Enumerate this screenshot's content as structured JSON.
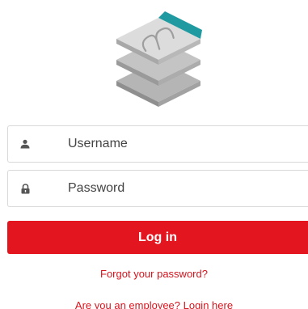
{
  "logo": {
    "icon": "layered-stack-logo",
    "accent_color": "#1f9aa0"
  },
  "username": {
    "placeholder": "Username",
    "icon": "user-icon"
  },
  "password": {
    "placeholder": "Password",
    "icon": "lock-icon"
  },
  "login_button": {
    "label": "Log in",
    "color": "#e3161f"
  },
  "forgot_link": "Forgot your password?",
  "employee_link": "Are you an employee? Login here",
  "colors": {
    "link": "#d6141d",
    "border": "#d9d9d9"
  }
}
